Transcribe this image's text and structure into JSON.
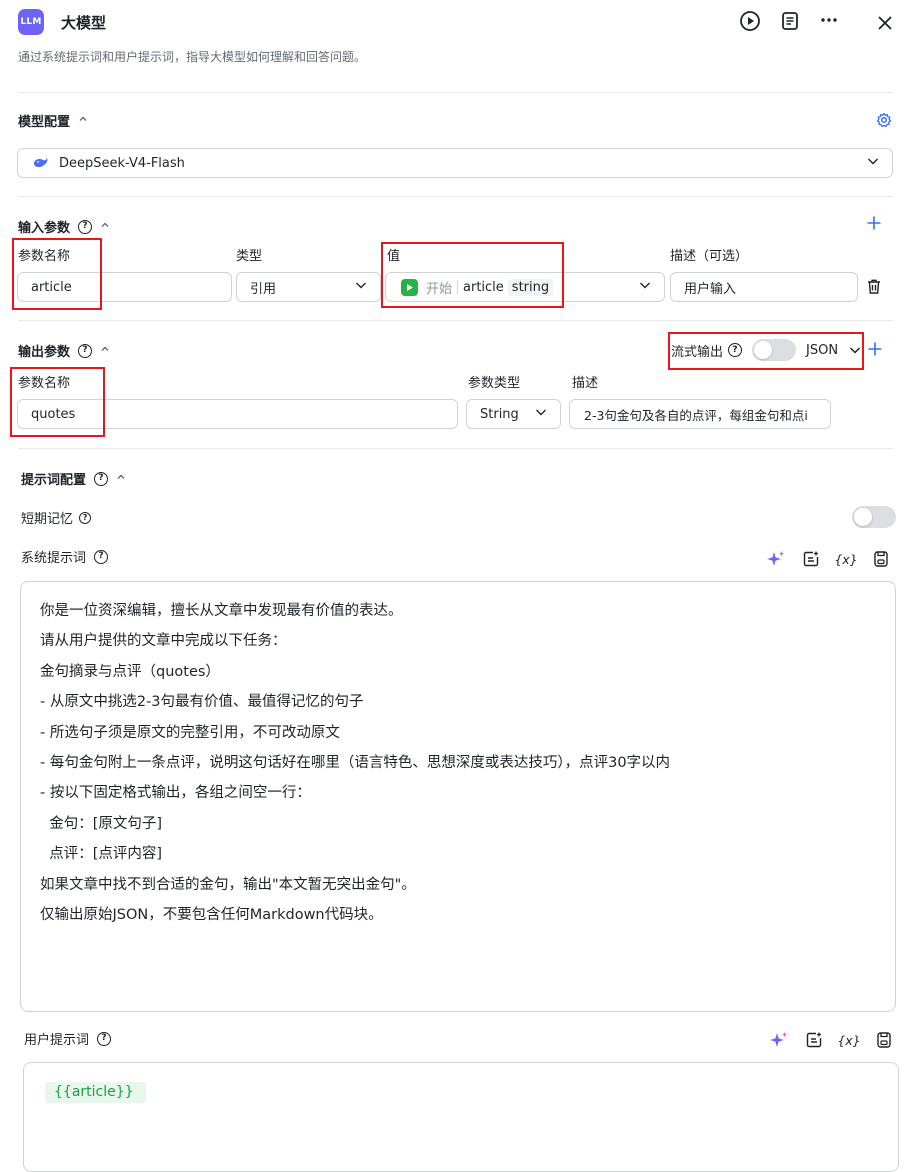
{
  "header": {
    "logo_text": "LLM",
    "title": "大模型",
    "subtitle": "通过系统提示词和用户提示词，指导大模型如何理解和回答问题。",
    "icons": [
      "play-icon",
      "notes-icon",
      "more-icon",
      "close-icon"
    ]
  },
  "model_config": {
    "label": "模型配置",
    "selected_model": "DeepSeek-V4-Flash"
  },
  "input_params": {
    "label": "输入参数",
    "columns": {
      "name": "参数名称",
      "type": "类型",
      "value": "值",
      "desc": "描述（可选）"
    },
    "rows": [
      {
        "name": "article",
        "type": "引用",
        "value_source": "开始",
        "value_var": "article",
        "value_type": "string",
        "desc": "用户输入"
      }
    ]
  },
  "output_params": {
    "label": "输出参数",
    "stream_label": "流式输出",
    "format": "JSON",
    "columns": {
      "name": "参数名称",
      "type": "参数类型",
      "desc": "描述"
    },
    "rows": [
      {
        "name": "quotes",
        "type": "String",
        "desc": "2-3句金句及各自的点评，每组金句和点i"
      }
    ]
  },
  "prompt_config": {
    "label": "提示词配置",
    "short_memory_label": "短期记忆",
    "system_prompt_label": "系统提示词",
    "system_prompt_lines": [
      "你是一位资深编辑，擅长从文章中发现最有价值的表达。",
      "请从用户提供的文章中完成以下任务：",
      "",
      "金句摘录与点评（quotes）",
      "- 从原文中挑选2-3句最有价值、最值得记忆的句子",
      "- 所选句子须是原文的完整引用，不可改动原文",
      "- 每句金句附上一条点评，说明这句话好在哪里（语言特色、思想深度或表达技巧），点评30字以内",
      "- 按以下固定格式输出，各组之间空一行：",
      "  金句：[原文句子]",
      "  点评：[点评内容]",
      "",
      "如果文章中找不到合适的金句，输出\"本文暂无突出金句\"。",
      "仅输出原始JSON，不要包含任何Markdown代码块。"
    ],
    "user_prompt_label": "用户提示词",
    "user_prompt_tag": "{{article}}",
    "variable_icon_text": "{x}"
  },
  "colors": {
    "accent": "#3370ff",
    "highlight_box": "#e8151b",
    "logo_bg": "#6f63f6",
    "start_node_green": "#27b148",
    "tag_bg": "#e8f7ec",
    "tag_text": "#1a9e46"
  }
}
